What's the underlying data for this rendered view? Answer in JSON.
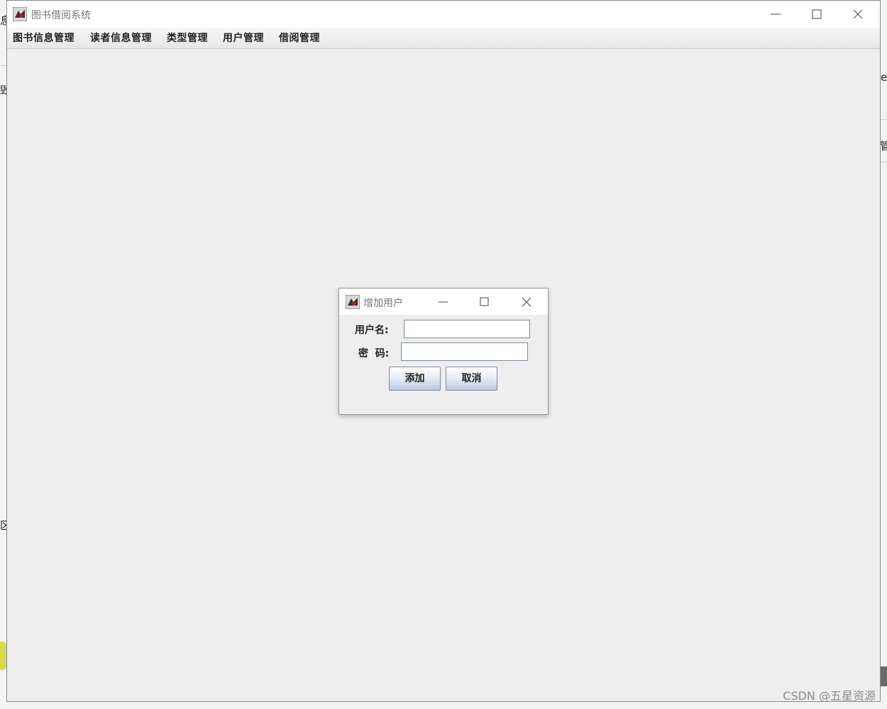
{
  "background": {
    "frag_top_left": "息",
    "frag_mid_left": "毁",
    "frag_right_e": "e",
    "frag_right_guan": "管",
    "frag_bottom_left": "区"
  },
  "window": {
    "title": "图书借阅系统",
    "icon": "java-app-icon"
  },
  "menu": {
    "items": [
      {
        "label": "图书信息管理"
      },
      {
        "label": "读者信息管理"
      },
      {
        "label": "类型管理"
      },
      {
        "label": "用户管理"
      },
      {
        "label": "借阅管理"
      }
    ]
  },
  "dialog": {
    "title": "增加用户",
    "icon": "java-app-icon",
    "username_label": "用户名:",
    "username_value": "",
    "password_label": "密  码:",
    "password_value": "",
    "add_label": "添加",
    "cancel_label": "取消"
  },
  "watermark": "CSDN @五星资源",
  "colors": {
    "window_bg": "#eeeeee",
    "titlebar_bg": "#ffffff",
    "button_gradient_bottom": "#b8cbe0"
  }
}
